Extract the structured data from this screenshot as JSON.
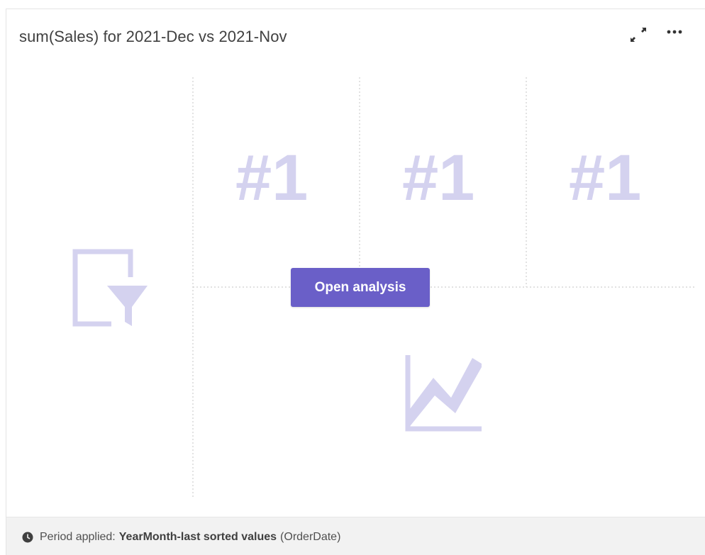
{
  "card": {
    "title": "sum(Sales) for 2021-Dec vs 2021-Nov",
    "expand_icon": "expand-arrows-icon",
    "more_icon": "more-options-icon"
  },
  "placeholder": {
    "rank_labels": [
      "#1",
      "#1",
      "#1"
    ],
    "filter_icon": "filter-pane-icon",
    "trend_icon": "line-chart-icon",
    "placeholder_color": "#d4d2ef"
  },
  "actions": {
    "open_analysis_label": "Open analysis",
    "accent_color": "#6a5fc8"
  },
  "footer": {
    "clock_icon": "clock-icon",
    "period_label": "Period applied:",
    "period_value": "YearMonth-last sorted values",
    "period_field": "(OrderDate)"
  }
}
